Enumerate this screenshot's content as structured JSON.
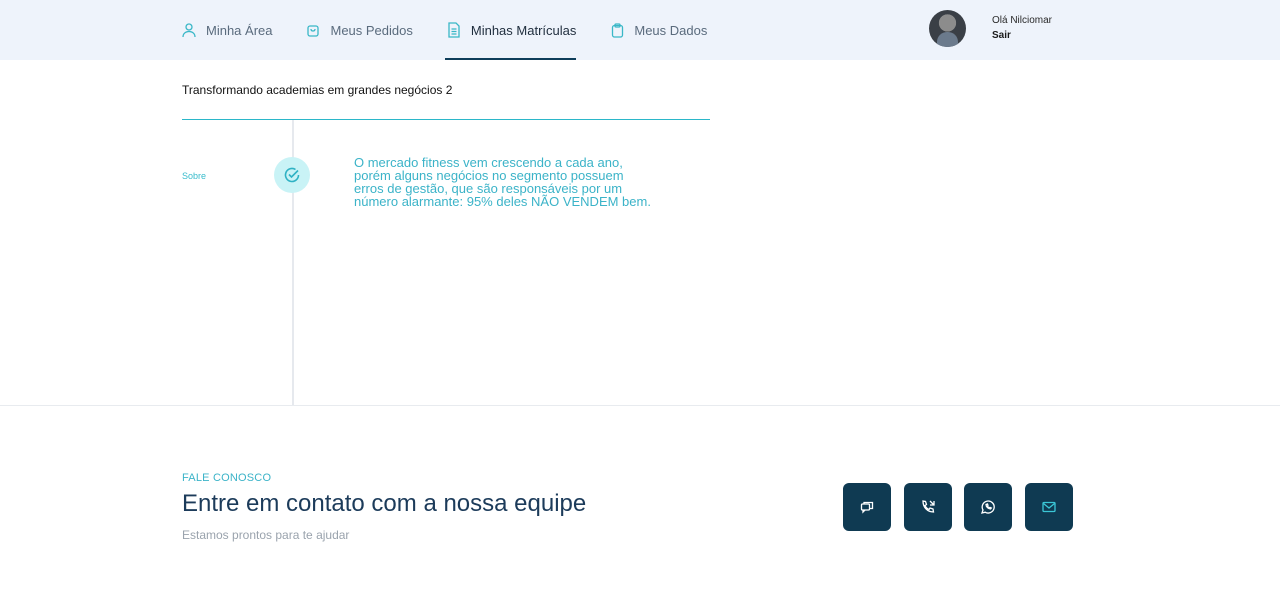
{
  "nav": {
    "items": [
      {
        "label": "Minha Área",
        "icon": "user-icon",
        "active": false
      },
      {
        "label": "Meus Pedidos",
        "icon": "bag-icon",
        "active": false
      },
      {
        "label": "Minhas Matrículas",
        "icon": "document-icon",
        "active": true
      },
      {
        "label": "Meus Dados",
        "icon": "clipboard-icon",
        "active": false
      }
    ]
  },
  "user": {
    "greeting": "Olá Nilciomar",
    "logout_label": "Sair"
  },
  "course": {
    "title": "Transformando academias em grandes negócios 2",
    "section_label": "Sobre",
    "description": "O mercado fitness vem crescendo a cada ano, porém alguns negócios no segmento possuem erros de gestão, que são responsáveis por um número alarmante: 95% deles NÃO VENDEM bem."
  },
  "contact": {
    "kicker": "FALE CONOSCO",
    "title": "Entre em contato com a nossa equipe",
    "subtitle": "Estamos prontos para te ajudar",
    "buttons": [
      "chat-icon",
      "phone-icon",
      "whatsapp-icon",
      "mail-icon"
    ]
  },
  "colors": {
    "accent": "#3bb3c8",
    "dark": "#0f3a52",
    "header_bg": "#eef3fb"
  }
}
